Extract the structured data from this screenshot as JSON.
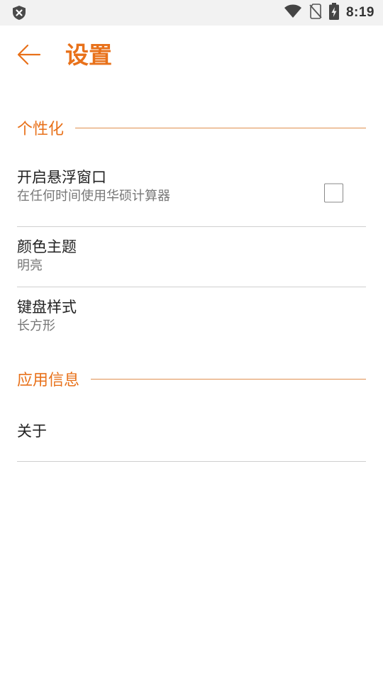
{
  "status_bar": {
    "time": "8:19",
    "icons": [
      "shield-icon",
      "wifi-icon",
      "no-sim-icon",
      "battery-charging-icon"
    ]
  },
  "toolbar": {
    "title": "设置",
    "back_icon": "arrow-left-icon"
  },
  "sections": [
    {
      "label": "个性化",
      "items": [
        {
          "title": "开启悬浮窗口",
          "summary": "在任何时间使用华硕计算器",
          "checkbox": false
        },
        {
          "title": "颜色主题",
          "summary": "明亮"
        },
        {
          "title": "键盘样式",
          "summary": "长方形"
        }
      ]
    },
    {
      "label": "应用信息",
      "items": [
        {
          "title": "关于"
        }
      ]
    }
  ],
  "colors": {
    "accent": "#e8711a",
    "divider": "#cfcfcf",
    "status_bar_bg": "#f2f2f2"
  }
}
